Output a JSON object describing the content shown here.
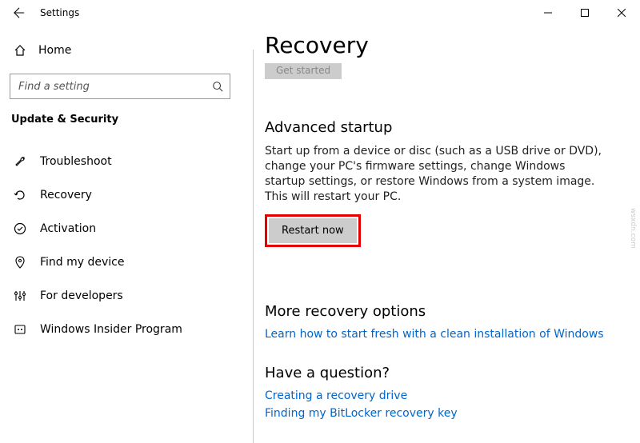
{
  "titlebar": {
    "title": "Settings"
  },
  "sidebar": {
    "home_label": "Home",
    "search_placeholder": "Find a setting",
    "category": "Update & Security",
    "items": [
      {
        "label": "Troubleshoot"
      },
      {
        "label": "Recovery"
      },
      {
        "label": "Activation"
      },
      {
        "label": "Find my device"
      },
      {
        "label": "For developers"
      },
      {
        "label": "Windows Insider Program"
      }
    ]
  },
  "content": {
    "heading": "Recovery",
    "ghost_button": "Get started",
    "advanced": {
      "title": "Advanced startup",
      "body": "Start up from a device or disc (such as a USB drive or DVD), change your PC's firmware settings, change Windows startup settings, or restore Windows from a system image. This will restart your PC.",
      "button": "Restart now"
    },
    "more": {
      "title": "More recovery options",
      "link": "Learn how to start fresh with a clean installation of Windows"
    },
    "question": {
      "title": "Have a question?",
      "link1": "Creating a recovery drive",
      "link2": "Finding my BitLocker recovery key"
    }
  },
  "watermark": "wsxdn.com"
}
